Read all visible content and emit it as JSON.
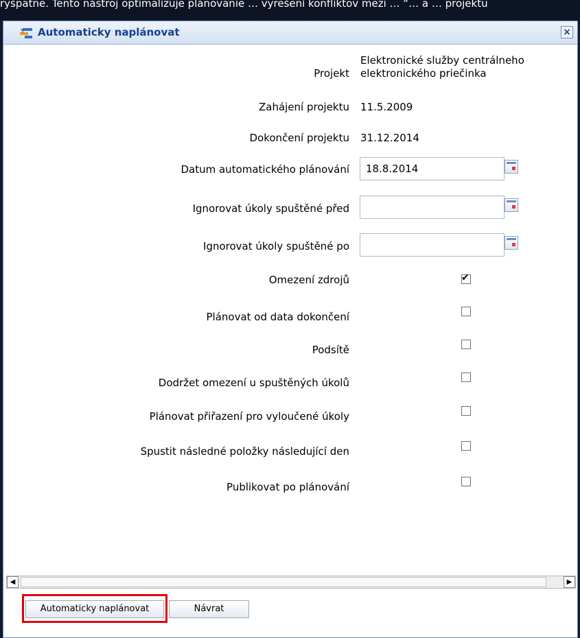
{
  "background_text": "ryšpatne. Tento nástroj optimalizuje plánovanie … vyrešení konfliktov mezi … “… a … projektu",
  "dialog": {
    "title": "Automaticky naplánovat",
    "close_label": "×"
  },
  "info": [
    {
      "label": "Projekt",
      "value_lines": [
        "Elektronické služby centrálneho",
        "elektronického priečinka"
      ]
    },
    {
      "label": "Zahájení projektu",
      "value": "11.5.2009"
    },
    {
      "label": "Dokončení projektu",
      "value": "31.12.2014"
    }
  ],
  "date_fields": [
    {
      "label": "Datum automatického plánování",
      "value": "18.8.2014"
    },
    {
      "label": "Ignorovat úkoly spuštěné před",
      "value": ""
    },
    {
      "label": "Ignorovat úkoly spuštěné po",
      "value": ""
    }
  ],
  "options": [
    {
      "label": "Omezení zdrojů",
      "checked": true
    },
    {
      "label": "Plánovat od data dokončení",
      "checked": false
    },
    {
      "label": "Podsítě",
      "checked": false
    },
    {
      "label": "Dodržet omezení u spuštěných úkolů",
      "checked": false
    },
    {
      "label": "Plánovat přiřazení pro vyloučené úkoly",
      "checked": false
    },
    {
      "label": "Spustit následné položky následující den",
      "checked": false
    },
    {
      "label": "Publikovat po plánování",
      "checked": false
    }
  ],
  "scrollbar": {
    "left_arrow": "◀",
    "right_arrow": "▶"
  },
  "buttons": {
    "schedule_label": "Automaticky naplánovat",
    "back_label": "Návrat"
  },
  "highlight_color": "#e00000"
}
